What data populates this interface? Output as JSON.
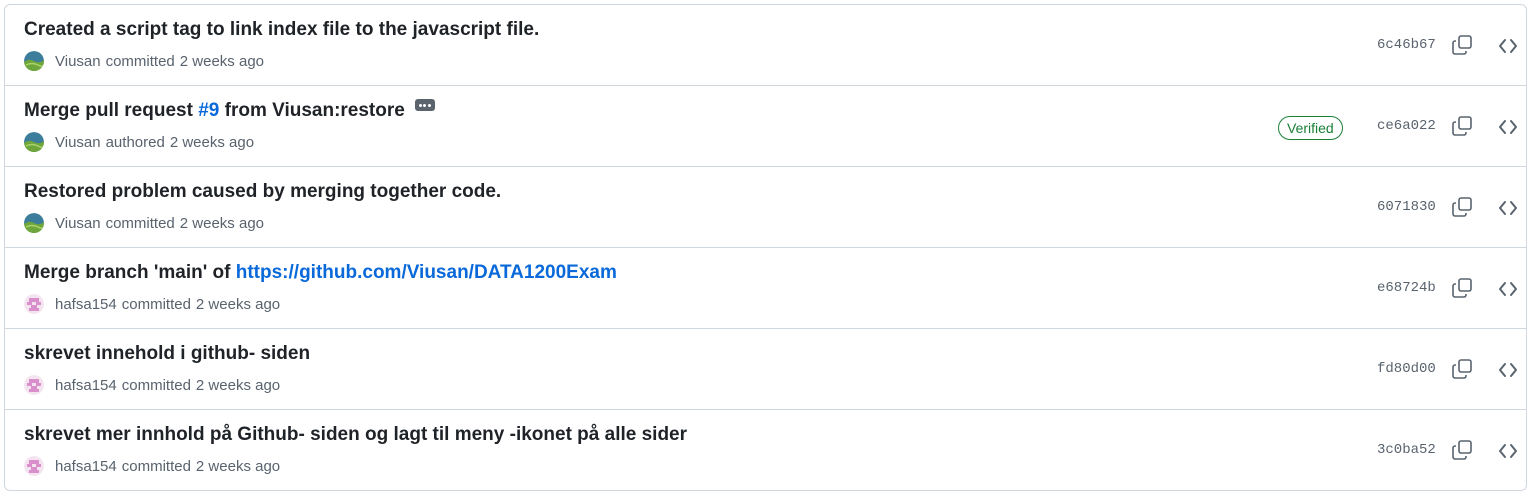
{
  "commits": [
    {
      "title": "Created a script tag to link index file to the javascript file.",
      "author": "Viusan",
      "action": "committed",
      "time": "2 weeks ago",
      "sha": "6c46b67",
      "verified": "",
      "avatar": "viusan"
    },
    {
      "title_prefix": "Merge pull request ",
      "title_link": "#9",
      "title_suffix": " from Viusan:restore",
      "author": "Viusan",
      "action": "authored",
      "time": "2 weeks ago",
      "sha": "ce6a022",
      "verified": "Verified",
      "avatar": "viusan"
    },
    {
      "title": "Restored problem caused by merging together code.",
      "author": "Viusan",
      "action": "committed",
      "time": "2 weeks ago",
      "sha": "6071830",
      "verified": "",
      "avatar": "viusan"
    },
    {
      "title_prefix": "Merge branch 'main' of ",
      "title_link": "https://github.com/Viusan/DATA1200Exam",
      "title_suffix": "",
      "author": "hafsa154",
      "action": "committed",
      "time": "2 weeks ago",
      "sha": "e68724b",
      "verified": "",
      "avatar": "hafsa154"
    },
    {
      "title": "skrevet innehold i github- siden",
      "author": "hafsa154",
      "action": "committed",
      "time": "2 weeks ago",
      "sha": "fd80d00",
      "verified": "",
      "avatar": "hafsa154"
    },
    {
      "title": "skrevet mer innhold på Github- siden og lagt til meny -ikonet på alle sider",
      "author": "hafsa154",
      "action": "committed",
      "time": "2 weeks ago",
      "sha": "3c0ba52",
      "verified": "",
      "avatar": "hafsa154"
    }
  ],
  "icons": {
    "copy": "copy-icon",
    "browse": "code-icon",
    "expand": "kebab-horizontal-icon"
  },
  "colors": {
    "link": "#0969da",
    "verified": "#1a7f37",
    "muted": "#59636e",
    "border": "#d0d7de"
  }
}
